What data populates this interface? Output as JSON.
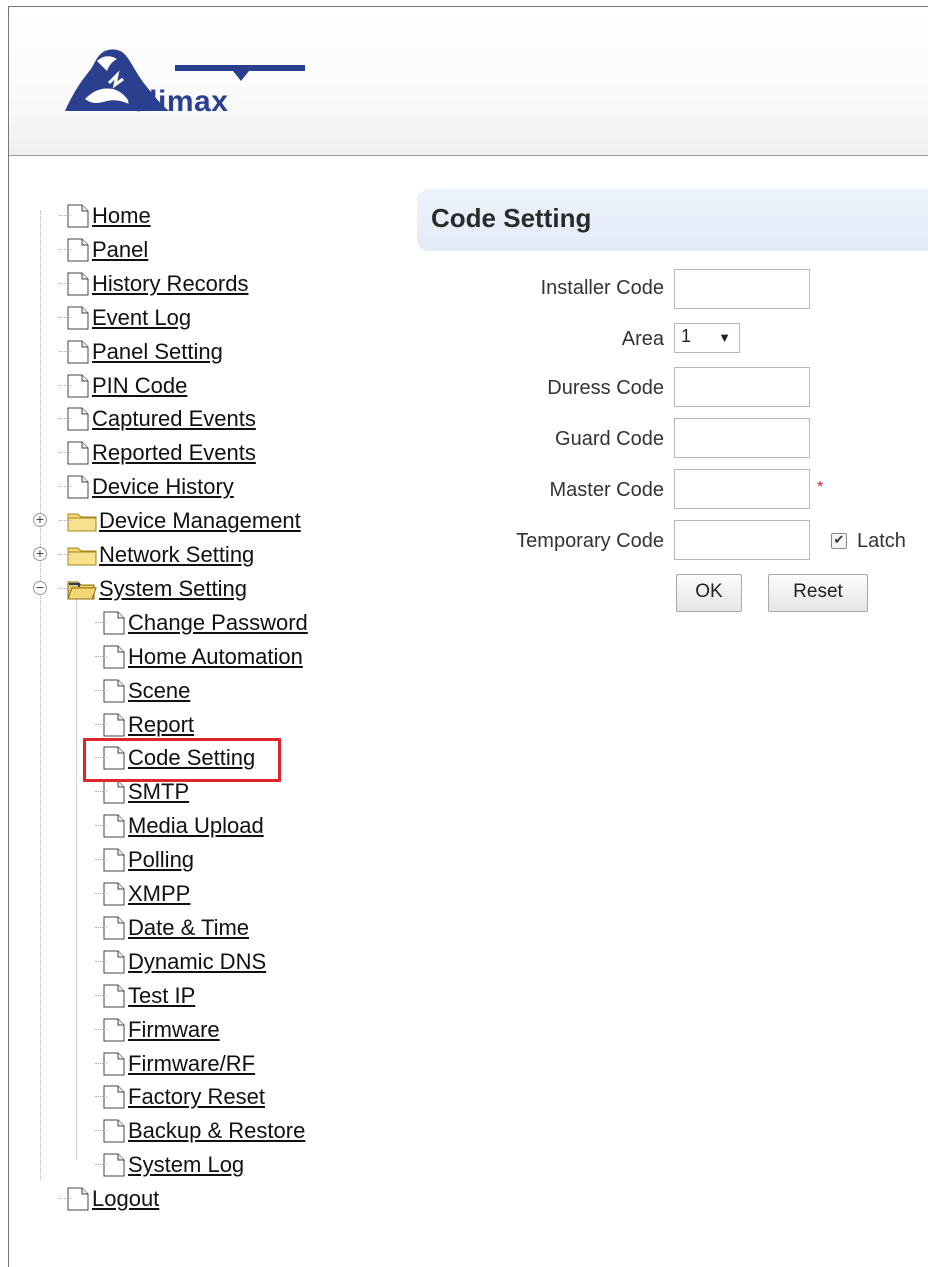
{
  "brand": {
    "name": "Climax",
    "color": "#2b3f8f"
  },
  "sidebar": {
    "items": [
      {
        "label": "Home",
        "icon": "doc-icon"
      },
      {
        "label": "Panel",
        "icon": "doc-icon"
      },
      {
        "label": "History Records",
        "icon": "doc-icon"
      },
      {
        "label": "Event Log",
        "icon": "doc-icon"
      },
      {
        "label": "Panel Setting",
        "icon": "doc-icon"
      },
      {
        "label": "PIN Code",
        "icon": "doc-icon"
      },
      {
        "label": "Captured Events",
        "icon": "doc-icon"
      },
      {
        "label": "Reported Events",
        "icon": "doc-icon"
      },
      {
        "label": "Device History",
        "icon": "doc-icon"
      },
      {
        "label": "Device Management",
        "icon": "folder-closed-icon",
        "expander": "+"
      },
      {
        "label": "Network Setting",
        "icon": "folder-closed-icon",
        "expander": "+"
      },
      {
        "label": "System Setting",
        "icon": "folder-open-icon",
        "expander": "−"
      }
    ],
    "system_children": [
      "Change Password",
      "Home Automation",
      "Scene",
      "Report",
      "Code Setting",
      "SMTP",
      "Media Upload",
      "Polling",
      "XMPP",
      "Date & Time",
      "Dynamic DNS",
      "Test IP",
      "Firmware",
      "Firmware/RF",
      "Factory Reset",
      "Backup & Restore",
      "System Log"
    ],
    "footer_item": {
      "label": "Logout",
      "icon": "doc-icon"
    },
    "selected": "Code Setting",
    "highlight_color": "#e0262c"
  },
  "main": {
    "title": "Code Setting",
    "fields": {
      "installer_code": {
        "label": "Installer Code",
        "value": ""
      },
      "area": {
        "label": "Area",
        "value": "1"
      },
      "duress_code": {
        "label": "Duress Code",
        "value": ""
      },
      "guard_code": {
        "label": "Guard Code",
        "value": ""
      },
      "master_code": {
        "label": "Master Code",
        "value": "",
        "required_mark": "*"
      },
      "temporary_code": {
        "label": "Temporary Code",
        "value": ""
      }
    },
    "latch": {
      "label": "Latch",
      "checked": true,
      "check_glyph": "✔"
    },
    "buttons": {
      "ok": "OK",
      "reset": "Reset"
    }
  }
}
